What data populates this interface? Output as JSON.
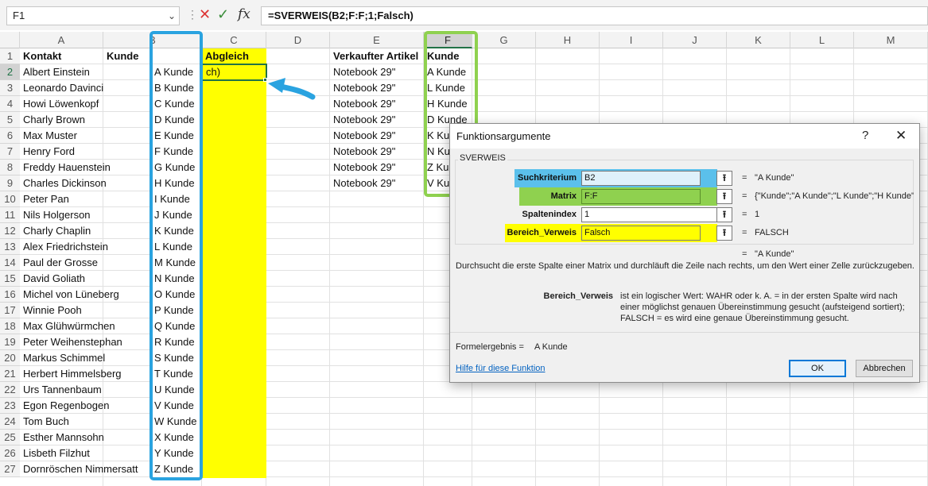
{
  "formula_bar": {
    "name_box": "F1",
    "formula": "=SVERWEIS(B2;F:F;1;Falsch)",
    "separator": "⋮",
    "cancel_icon": "✕",
    "enter_icon": "✓",
    "function_icon": "fx"
  },
  "columns": [
    "A",
    "B",
    "C",
    "D",
    "E",
    "F",
    "G",
    "H",
    "I",
    "J",
    "K",
    "L",
    "M"
  ],
  "rows": [
    "1",
    "2",
    "3",
    "4",
    "5",
    "6",
    "7",
    "8",
    "9",
    "10",
    "11",
    "12",
    "13",
    "14",
    "15",
    "16",
    "17",
    "18",
    "19",
    "20",
    "21",
    "22",
    "23",
    "24",
    "25",
    "26",
    "27"
  ],
  "sheet": {
    "header": {
      "kontakt": "Kontakt",
      "kunde": "Kunde",
      "abgleich": "Abgleich",
      "artikel": "Verkaufter Artikel",
      "kunde_f": "Kunde"
    },
    "active_cell_text": "ch)",
    "col_a": [
      "Albert Einstein",
      "Leonardo Davinci",
      "Howi Löwenkopf",
      "Charly Brown",
      "Max Muster",
      "Henry Ford",
      "Freddy Hauenstein",
      "Charles Dickinson",
      "Peter Pan",
      "Nils Holgerson",
      "Charly Chaplin",
      "Alex Friedrichstein",
      "Paul der Grosse",
      "David Goliath",
      "Michel von Lüneberg",
      "Winnie Pooh",
      "Max Glühwürmchen",
      "Peter Weihenstephan",
      "Markus Schimmel",
      "Herbert Himmelsberg",
      "Urs Tannenbaum",
      "Egon Regenbogen",
      "Tom Buch",
      "Esther Mannsohn",
      "Lisbeth Filzhut",
      "Dornröschen Nimmersatt"
    ],
    "col_b": [
      "A Kunde",
      "B Kunde",
      "C Kunde",
      "D Kunde",
      "E Kunde",
      "F Kunde",
      "G Kunde",
      "H Kunde",
      "I Kunde",
      "J Kunde",
      "K Kunde",
      "L Kunde",
      "M Kunde",
      "N Kunde",
      "O Kunde",
      "P Kunde",
      "Q Kunde",
      "R Kunde",
      "S Kunde",
      "T Kunde",
      "U Kunde",
      "V Kunde",
      "W Kunde",
      "X Kunde",
      "Y Kunde",
      "Z Kunde"
    ],
    "col_e": [
      "Notebook 29\"",
      "Notebook 29\"",
      "Notebook 29\"",
      "Notebook 29\"",
      "Notebook 29\"",
      "Notebook 29\"",
      "Notebook 29\"",
      "Notebook 29\""
    ],
    "col_f": [
      "A Kunde",
      "L Kunde",
      "H Kunde",
      "D Kunde",
      "K Kunde",
      "N Kunde",
      "Z Kunde",
      "V Kunde"
    ]
  },
  "dialog": {
    "title": "Funktionsargumente",
    "help_icon": "?",
    "close_icon": "✕",
    "function_name": "SVERWEIS",
    "args": [
      {
        "label": "Suchkriterium",
        "value": "B2",
        "result": "\"A Kunde\""
      },
      {
        "label": "Matrix",
        "value": "F:F",
        "result": "{\"Kunde\";\"A Kunde\";\"L Kunde\";\"H Kunde\";\"D Kunde\";\"K Kunde\";\"N Kunde\";\"Z Kunde\";\"V Kunde\""
      },
      {
        "label": "Spaltenindex",
        "value": "1",
        "result": "1"
      },
      {
        "label": "Bereich_Verweis",
        "value": "Falsch",
        "result": "FALSCH"
      }
    ],
    "collapse_icon": "⭱",
    "equals": "=",
    "function_result": "\"A Kunde\"",
    "description": "Durchsucht die erste Spalte einer Matrix und durchläuft die Zeile nach rechts, um den Wert einer Zelle zurückzugeben.",
    "param_name": "Bereich_Verweis",
    "param_description": "ist ein logischer Wert: WAHR oder k. A. = in der ersten Spalte wird nach einer möglichst genauen Übereinstimmung gesucht (aufsteigend sortiert); FALSCH = es wird eine genaue Übereinstimmung gesucht.",
    "result_label": "Formelergebnis =",
    "result_value": "A Kunde",
    "help_link": "Hilfe für diese Funktion",
    "ok_label": "OK",
    "cancel_label": "Abbrechen"
  },
  "colors": {
    "highlight_yellow": "#ffff00",
    "box_blue": "#2aa3e0",
    "box_green": "#8fd14f",
    "excel_green": "#217346",
    "label_blue": "#5bc0eb",
    "label_green": "#8fd14f"
  }
}
